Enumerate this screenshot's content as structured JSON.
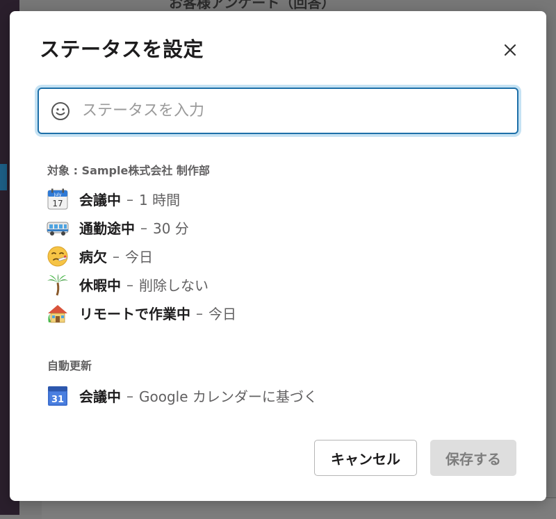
{
  "background": {
    "title": "お客様アンケート（回答）"
  },
  "modal": {
    "title": "ステータスを設定",
    "close_icon": "close-icon",
    "input": {
      "placeholder": "ステータスを入力",
      "value": "",
      "icon": "smiley-icon"
    },
    "presets_label": "対象 : Sample株式会社 制作部",
    "presets": [
      {
        "icon": "calendar-icon",
        "name": "会議中",
        "dash": "–",
        "duration": "1 時間"
      },
      {
        "icon": "bus-icon",
        "name": "通勤途中",
        "dash": "–",
        "duration": "30 分"
      },
      {
        "icon": "sick-face-icon",
        "name": "病欠",
        "dash": "–",
        "duration": "今日"
      },
      {
        "icon": "palm-tree-icon",
        "name": "休暇中",
        "dash": "–",
        "duration": "削除しない"
      },
      {
        "icon": "house-icon",
        "name": "リモートで作業中",
        "dash": "–",
        "duration": "今日"
      }
    ],
    "auto_label": "自動更新",
    "auto": [
      {
        "icon": "google-calendar-icon",
        "name": "会議中",
        "dash": "–",
        "duration": "Google カレンダーに基づく"
      }
    ],
    "cancel_label": "キャンセル",
    "save_label": "保存する"
  },
  "colors": {
    "accent": "#1d6fa8",
    "focus_ring": "#c5e2f3",
    "save_disabled": "#dedede"
  }
}
